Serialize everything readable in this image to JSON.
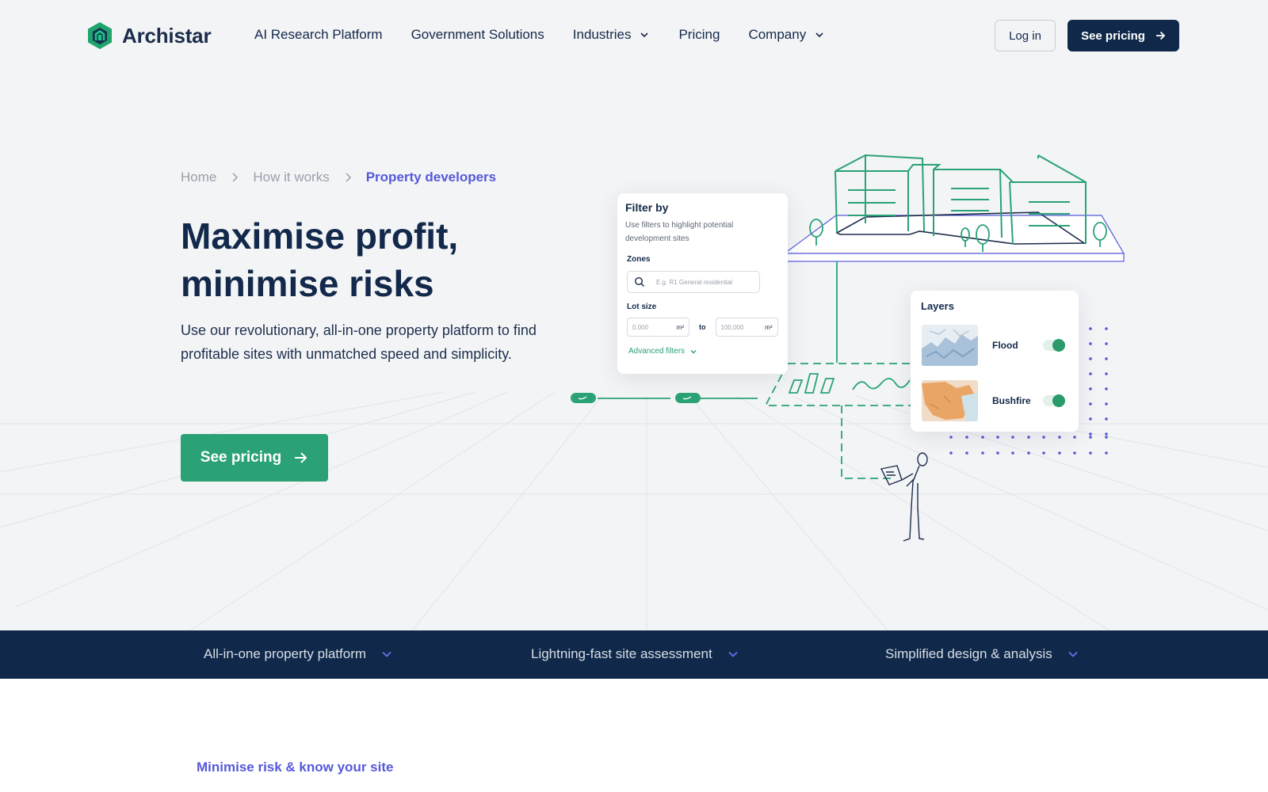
{
  "brand": {
    "name": "Archistar",
    "accent": "#2aa276",
    "navy": "#10294a",
    "indigo": "#5559d9"
  },
  "nav": {
    "items": [
      {
        "label": "AI Research Platform"
      },
      {
        "label": "Government Solutions"
      },
      {
        "label": "Industries"
      },
      {
        "label": "Pricing"
      },
      {
        "label": "Company"
      }
    ],
    "login_label": "Log in",
    "cta_label": "See pricing"
  },
  "breadcrumb": [
    "Home",
    "How it works",
    "Property developers"
  ],
  "hero": {
    "title_line1": "Maximise profit,",
    "title_line2": "minimise risks",
    "description": "Use our revolutionary, all-in-one property platform to find profitable sites with unmatched speed and simplicity.",
    "cta_label": "See pricing"
  },
  "filter_card": {
    "title": "Filter by",
    "description": "Use filters to highlight potential development sites",
    "zones_label": "Zones",
    "zones_placeholder": "E.g. R1 General residential",
    "lot_size_label": "Lot size",
    "min_value": "0.000",
    "max_value": "100,000",
    "unit": "m²",
    "to_label": "to",
    "advanced_label": "Advanced filters"
  },
  "layers_card": {
    "title": "Layers",
    "layers": [
      {
        "name": "Flood",
        "enabled": true
      },
      {
        "name": "Bushfire",
        "enabled": true
      }
    ]
  },
  "features": [
    {
      "label": "All-in-one property platform"
    },
    {
      "label": "Lightning-fast site assessment"
    },
    {
      "label": "Simplified design & analysis"
    }
  ],
  "section": {
    "subheading": "Minimise risk & know your site"
  }
}
